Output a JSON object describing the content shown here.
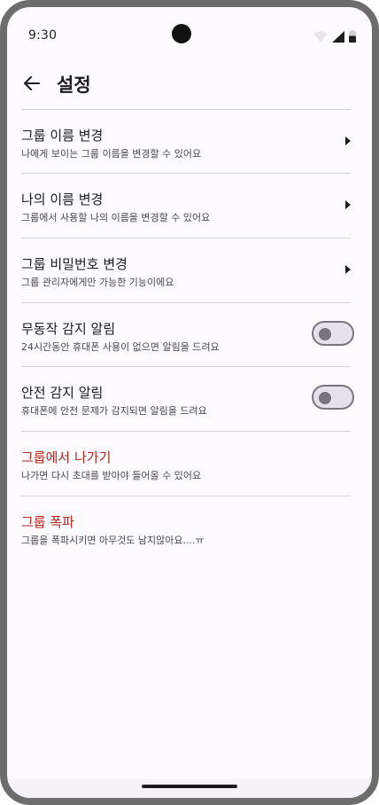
{
  "status_bar": {
    "time": "9:30",
    "icons": [
      "wifi-icon",
      "signal-icon",
      "battery-icon"
    ]
  },
  "app_bar": {
    "back_icon": "arrow-left-icon",
    "title": "설정"
  },
  "settings": [
    {
      "title": "그룹 이름 변경",
      "subtitle": "나에게 보이는 그룹 이름을 변경할 수 있어요",
      "control": "chevron"
    },
    {
      "title": "나의 이름 변경",
      "subtitle": "그룹에서 사용할 나의 이름을 변경할 수 있어요",
      "control": "chevron"
    },
    {
      "title": "그룹 비밀번호 변경",
      "subtitle": "그룹 관리자에게만 가능한 기능이에요",
      "control": "chevron"
    },
    {
      "title": "무동작 감지 알림",
      "subtitle": "24시간동안 휴대폰 사용이 없으면 알림을 드려요",
      "control": "toggle",
      "on": false
    },
    {
      "title": "안전 감지 알림",
      "subtitle": "휴대폰에 안전 문제가 감지되면 알림을 드려요",
      "control": "toggle",
      "on": false
    },
    {
      "title": "그룹에서 나가기",
      "subtitle": "나가면 다시 초대를 받아야 들어올 수 있어요",
      "control": "none",
      "danger": true
    },
    {
      "title": "그룹 폭파",
      "subtitle": "그룹을 폭파시키면 아무것도 남지않아요....ㅠ",
      "control": "none",
      "danger": true
    }
  ],
  "colors": {
    "danger": "#b3261e",
    "background": "#fdfbfe",
    "divider": "#d3d1d5",
    "toggle_off": "#79747e"
  }
}
